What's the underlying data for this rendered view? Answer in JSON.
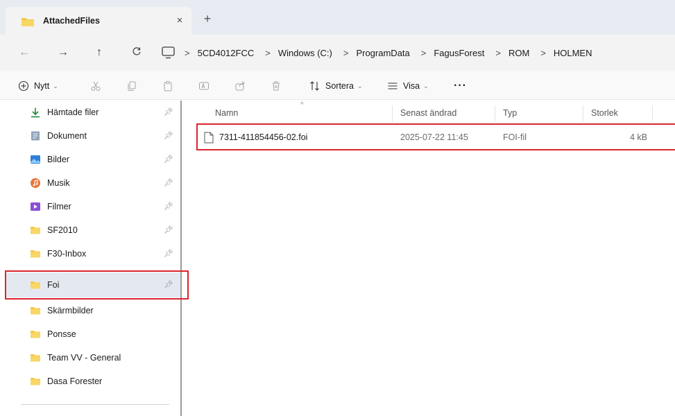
{
  "tab": {
    "title": "AttachedFiles",
    "close_glyph": "×",
    "new_tab_glyph": "+"
  },
  "nav": {
    "back_glyph": "←",
    "forward_glyph": "→",
    "up_glyph": "↑",
    "refresh_glyph": "C"
  },
  "breadcrumbs": {
    "separator": ">",
    "items": [
      "5CD4012FCC",
      "Windows (C:)",
      "ProgramData",
      "FagusForest",
      "ROM",
      "HOLMEN"
    ]
  },
  "toolbar": {
    "new_label": "Nytt",
    "sort_label": "Sortera",
    "view_label": "Visa",
    "more_glyph": "···"
  },
  "sidebar": {
    "items": [
      {
        "label": "Hämtade filer",
        "icon": "download-icon"
      },
      {
        "label": "Dokument",
        "icon": "document-icon"
      },
      {
        "label": "Bilder",
        "icon": "pictures-icon"
      },
      {
        "label": "Musik",
        "icon": "music-icon"
      },
      {
        "label": "Filmer",
        "icon": "videos-icon"
      },
      {
        "label": "SF2010",
        "icon": "folder-icon"
      },
      {
        "label": "F30-Inbox",
        "icon": "folder-icon"
      },
      {
        "label": "Foi",
        "icon": "folder-icon"
      },
      {
        "label": "Skärmbilder",
        "icon": "folder-icon"
      },
      {
        "label": "Ponsse",
        "icon": "folder-icon"
      },
      {
        "label": "Team VV - General",
        "icon": "folder-icon"
      },
      {
        "label": "Dasa Forester",
        "icon": "folder-icon"
      }
    ],
    "selected_label": "Foi"
  },
  "columns": {
    "name": "Namn",
    "modified": "Senast ändrad",
    "type": "Typ",
    "size": "Storlek"
  },
  "files": [
    {
      "name": "7311-411854456-02.foi",
      "modified": "2025-07-22 11:45",
      "type": "FOI-fil",
      "size": "4 kB"
    }
  ],
  "colors": {
    "highlight": "#d9242d",
    "folder_yellow": "#f4c542",
    "selected_bg": "#e4e9f1"
  }
}
